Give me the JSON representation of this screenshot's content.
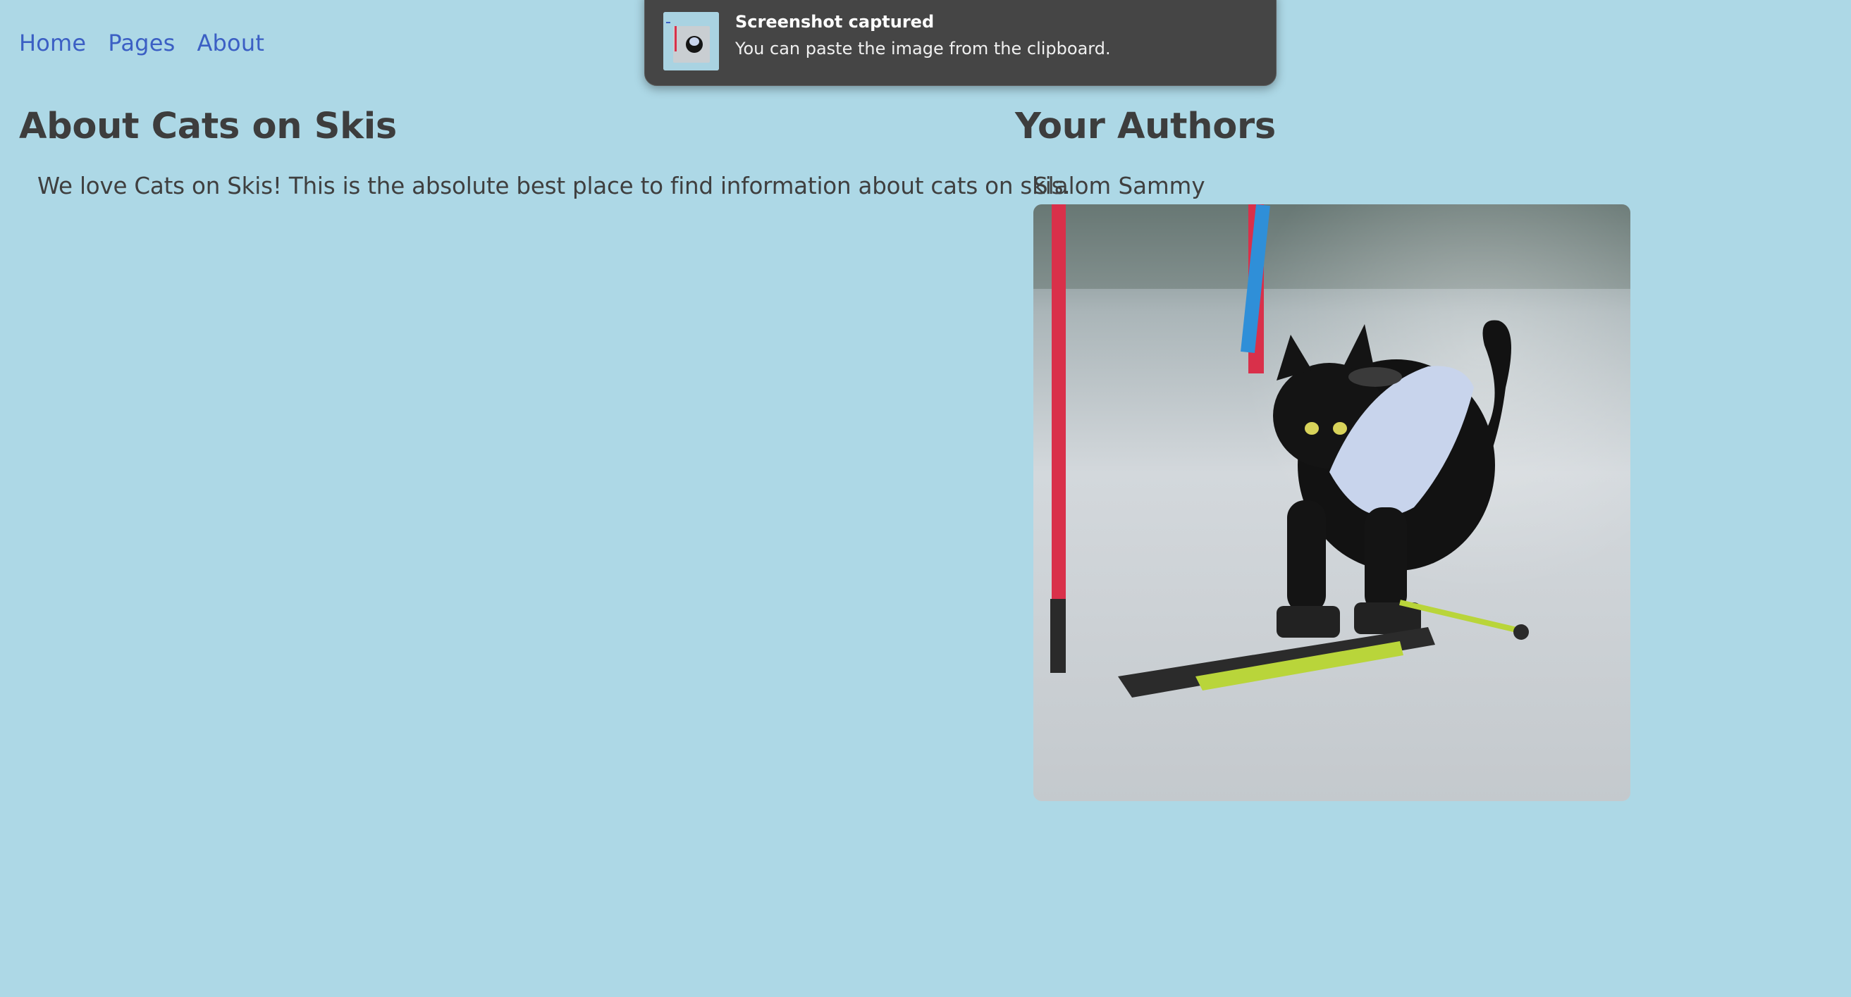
{
  "nav": {
    "items": [
      {
        "label": "Home"
      },
      {
        "label": "Pages"
      },
      {
        "label": "About"
      }
    ]
  },
  "about": {
    "heading": "About Cats on Skis",
    "text": "We love Cats on Skis! This is the absolute best place to find information about cats on skis."
  },
  "authors": {
    "heading": "Your Authors",
    "list": [
      {
        "name": "Slalom Sammy",
        "photo": "black cat skiing through slalom gates"
      }
    ]
  },
  "toast": {
    "title": "Screenshot captured",
    "body": "You can paste the image from the clipboard."
  },
  "colors": {
    "background": "#add8e6",
    "link": "#3b5fc4",
    "text": "#3f3f3f",
    "toast_bg": "#454545"
  }
}
